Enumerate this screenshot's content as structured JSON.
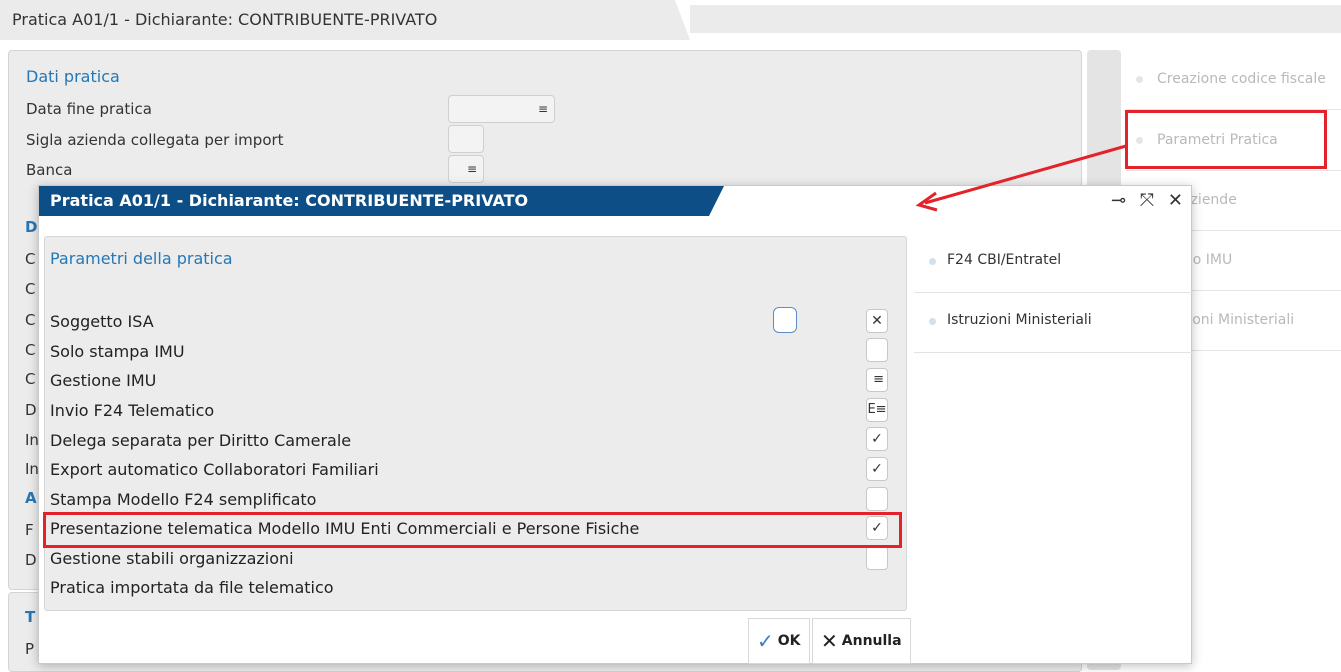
{
  "background": {
    "window_title": "Pratica A01/1 - Dichiarante: CONTRIBUENTE-PRIVATO",
    "section_title": "Dati pratica",
    "fields": [
      {
        "label": "Data fine pratica",
        "value": "≡"
      },
      {
        "label": "Sigla azienda collegata per import",
        "value": ""
      },
      {
        "label": "Banca",
        "value": "≡"
      }
    ],
    "partial_letters": [
      "D",
      "C",
      "C",
      "C",
      "C",
      "C",
      "D",
      "In",
      "In",
      "A",
      "F",
      "D",
      "T",
      "P"
    ],
    "side_menu": [
      "Creazione codice fiscale",
      "Parametri Pratica",
      "Aziende",
      "gno IMU",
      "zioni Ministeriali"
    ]
  },
  "dialog": {
    "title": "Pratica A01/1 - Dichiarante: CONTRIBUENTE-PRIVATO",
    "icons": [
      "pin-icon",
      "collapse-icon",
      "close-icon"
    ],
    "panel_title": "Parametri della pratica",
    "params": [
      {
        "label": "Soggetto ISA",
        "value": "✕"
      },
      {
        "label": "Solo stampa IMU",
        "value": ""
      },
      {
        "label": "Gestione IMU",
        "value": "≡"
      },
      {
        "label": "Invio F24 Telematico",
        "value": "E≡"
      },
      {
        "label": "Delega separata per Diritto Camerale",
        "value": "✓"
      },
      {
        "label": "Export automatico Collaboratori Familiari",
        "value": "✓"
      },
      {
        "label": "Stampa Modello F24 semplificato",
        "value": ""
      },
      {
        "label": "Presentazione telematica Modello IMU Enti Commerciali e Persone Fisiche",
        "value": "✓"
      },
      {
        "label": "Gestione stabili organizzazioni",
        "value": ""
      },
      {
        "label": "Pratica importata da file telematico",
        "value": ""
      }
    ],
    "side_menu": [
      "F24 CBI/Entratel",
      "Istruzioni Ministeriali"
    ],
    "buttons": {
      "ok": "OK",
      "cancel": "Annulla"
    }
  },
  "annotations": {
    "highlight_color": "#e3222a"
  }
}
